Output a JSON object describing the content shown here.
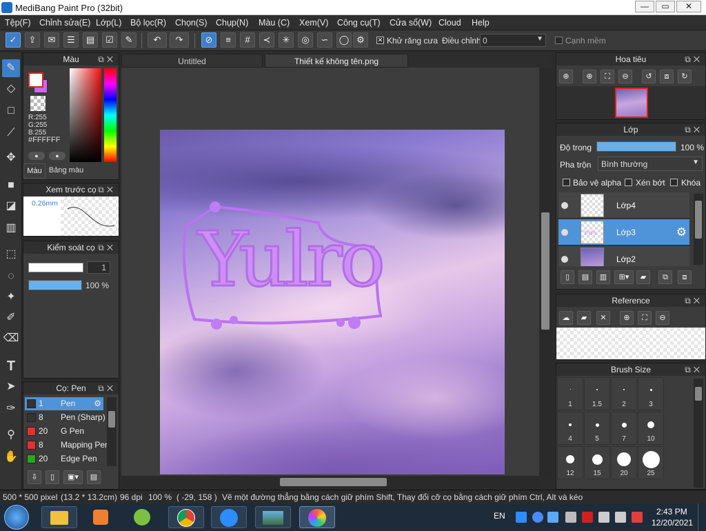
{
  "window": {
    "title": "MediBang Paint Pro (32bit)",
    "minimize": "—",
    "maximize": "▭",
    "close": "✕"
  },
  "menu": [
    "Tệp(F)",
    "Chỉnh sửa(E)",
    "Lớp(L)",
    "Bộ lọc(R)",
    "Chọn(S)",
    "Chụp(N)",
    "Màu (C)",
    "Xem(V)",
    "Công cụ(T)",
    "Cửa sổ(W)",
    "Cloud",
    "Help"
  ],
  "toolbar": {
    "antialias_label": "Khử răng cưa",
    "antialias_checked": true,
    "adjust_label": "Điều chỉnh",
    "adjust_value": "0",
    "soft_edge_label": "Cạnh mềm",
    "soft_edge_checked": false
  },
  "color_panel": {
    "title": "Màu",
    "r": "R:255",
    "g": "G:255",
    "b": "B:255",
    "hex": "#FFFFFF",
    "tab_color": "Màu",
    "tab_palette": "Bảng màu",
    "foreground": "#ffffff",
    "background": "#cc66ff",
    "border_accent": "#e02020"
  },
  "brush_preview": {
    "title": "Xem trước cọ",
    "size": "0.26mm"
  },
  "brush_control": {
    "title": "Kiểm soát cọ",
    "size_value": "1",
    "opacity_value": "100 %"
  },
  "brush_list": {
    "title": "Cọ: Pen",
    "items": [
      {
        "size": "1",
        "name": "Pen",
        "color": "#333333",
        "selected": true
      },
      {
        "size": "8",
        "name": "Pen (Sharp)",
        "color": "#333333",
        "selected": false
      },
      {
        "size": "20",
        "name": "G Pen",
        "color": "#e83030",
        "selected": false
      },
      {
        "size": "8",
        "name": "Mapping Pen",
        "color": "#e83030",
        "selected": false
      },
      {
        "size": "20",
        "name": "Edge Pen",
        "color": "#22aa22",
        "selected": false
      }
    ]
  },
  "tabs": [
    "Untitled",
    "Thiết kế không tên.png"
  ],
  "canvas_text": "Yulro",
  "navigator": {
    "title": "Hoa tiêu"
  },
  "layers": {
    "title": "Lớp",
    "opacity_label": "Độ trong",
    "opacity_value": "100 %",
    "blend_label": "Pha trộn",
    "blend_value": "Bình thường",
    "protect_alpha": "Bảo vệ alpha",
    "clipping": "Xén bớt",
    "lock": "Khóa",
    "items": [
      {
        "name": "Lớp4",
        "selected": false
      },
      {
        "name": "Lớp3",
        "selected": true
      },
      {
        "name": "Lớp2",
        "selected": false
      }
    ]
  },
  "reference": {
    "title": "Reference"
  },
  "brush_size": {
    "title": "Brush Size",
    "sizes": [
      "1",
      "1.5",
      "2",
      "3",
      "4",
      "5",
      "7",
      "10",
      "12",
      "15",
      "20",
      "25"
    ]
  },
  "status": {
    "dims": "500 * 500 pixel",
    "cm": "(13.2 * 13.2cm)",
    "dpi": "96 dpi",
    "zoom": "100 %",
    "coords": "( -29, 158 )",
    "hint": "Vẽ một đường thẳng bằng cách giữ phím Shift, Thay đổi cỡ cọ bằng cách giữ phím Ctrl, Alt và kéo"
  },
  "taskbar": {
    "lang": "EN",
    "time": "2:43 PM",
    "date": "12/20/2021"
  }
}
